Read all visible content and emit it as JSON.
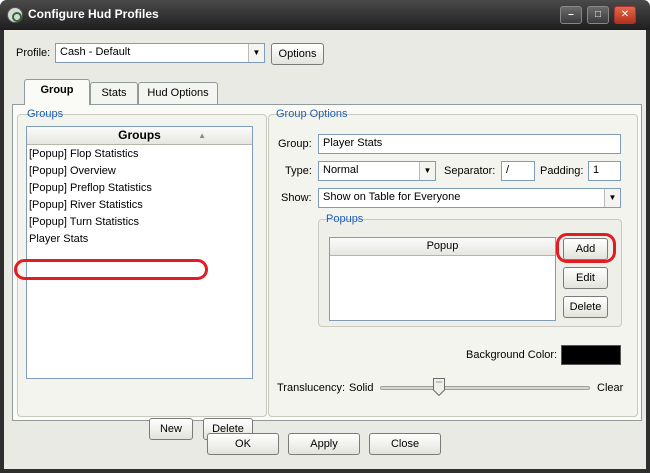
{
  "window": {
    "title": "Configure Hud Profiles"
  },
  "profile": {
    "label": "Profile:",
    "value": "Cash - Default",
    "options_button": "Options"
  },
  "tabs": [
    {
      "label": "Group"
    },
    {
      "label": "Stats"
    },
    {
      "label": "Hud Options"
    }
  ],
  "groups": {
    "section_title": "Groups",
    "column_header": "Groups",
    "items": [
      "[Popup] Flop Statistics",
      "[Popup] Overview",
      "[Popup] Preflop Statistics",
      "[Popup] River Statistics",
      "[Popup] Turn Statistics",
      "Player Stats"
    ],
    "new_button": "New",
    "delete_button": "Delete"
  },
  "group_options": {
    "section_title": "Group Options",
    "group_label": "Group:",
    "group_value": "Player Stats",
    "type_label": "Type:",
    "type_value": "Normal",
    "separator_label": "Separator:",
    "separator_value": "/",
    "padding_label": "Padding:",
    "padding_value": "1",
    "show_label": "Show:",
    "show_value": "Show on Table for Everyone",
    "popups": {
      "section_title": "Popups",
      "column_header": "Popup",
      "add_button": "Add",
      "edit_button": "Edit",
      "delete_button": "Delete"
    },
    "background_color_label": "Background Color:",
    "background_color": "#000000",
    "translucency": {
      "label": "Translucency:",
      "min_label": "Solid",
      "max_label": "Clear",
      "value_fraction": 0.28
    }
  },
  "footer": {
    "ok": "OK",
    "apply": "Apply",
    "close": "Close"
  },
  "colors": {
    "highlight": "#e31b23",
    "section_title": "#1d5fb8"
  }
}
